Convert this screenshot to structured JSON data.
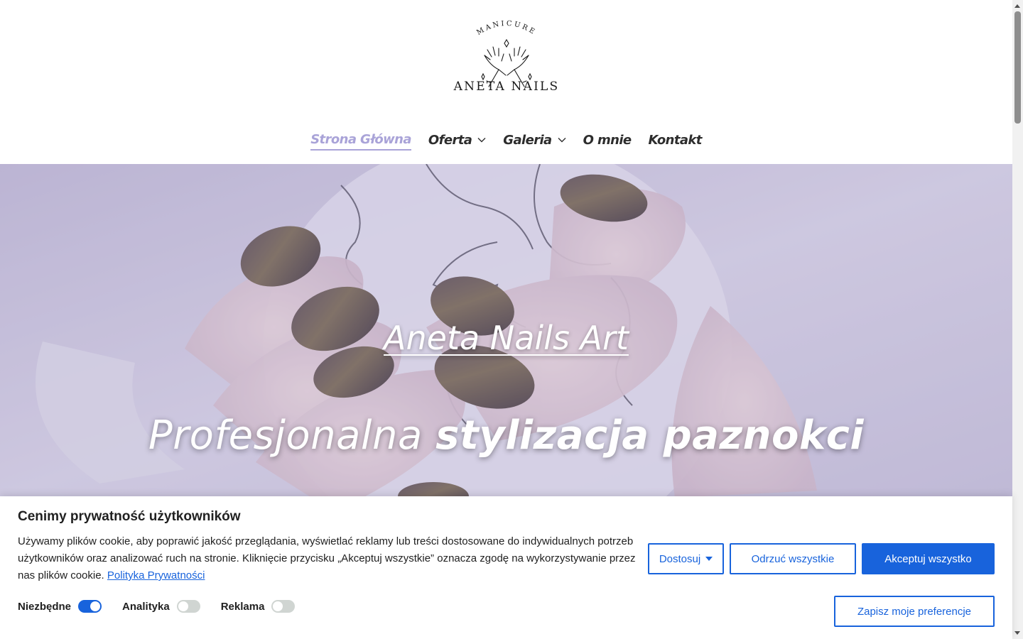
{
  "brand": {
    "tagline": "MANICURE",
    "name": "ANETA NAILS"
  },
  "nav": {
    "items": [
      {
        "label": "Strona Główna",
        "active": true,
        "dropdown": false
      },
      {
        "label": "Oferta",
        "active": false,
        "dropdown": true
      },
      {
        "label": "Galeria",
        "active": false,
        "dropdown": true
      },
      {
        "label": "O mnie",
        "active": false,
        "dropdown": false
      },
      {
        "label": "Kontakt",
        "active": false,
        "dropdown": false
      }
    ],
    "active_color": "#a9a3d8"
  },
  "hero": {
    "title": "Aneta Nails Art",
    "subtitle_light": "Profesjonalna",
    "subtitle_bold": "stylizacja paznokci"
  },
  "cookie": {
    "title": "Cenimy prywatność użytkowników",
    "text": "Używamy plików cookie, aby poprawić jakość przeglądania, wyświetlać reklamy lub treści dostosowane do indywidualnych potrzeb użytkowników oraz analizować ruch na stronie. Kliknięcie przycisku „Akceptuj wszystkie” oznacza zgodę na wykorzystywanie przez nas plików cookie.",
    "policy_link": "Polityka Prywatności",
    "buttons": {
      "customize": "Dostosuj",
      "reject": "Odrzuć wszystkie",
      "accept": "Akceptuj wszystko",
      "save": "Zapisz moje preferencje"
    },
    "toggles": [
      {
        "label": "Niezbędne",
        "on": true
      },
      {
        "label": "Analityka",
        "on": false
      },
      {
        "label": "Reklama",
        "on": false
      }
    ],
    "accent_color": "#1863dc"
  }
}
